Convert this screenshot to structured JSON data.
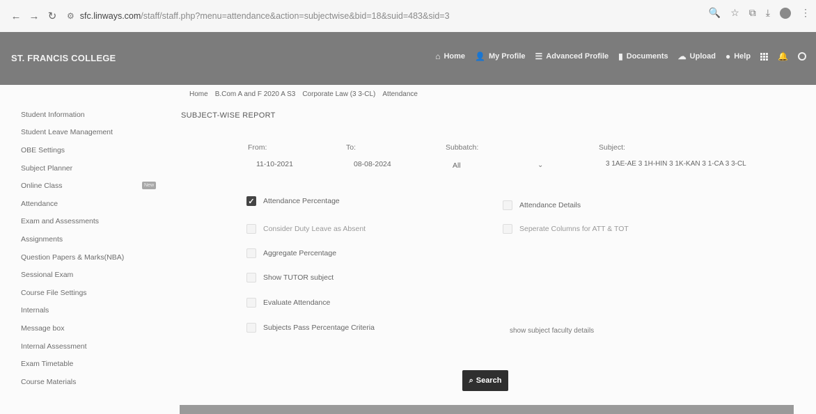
{
  "browser": {
    "url_domain": "sfc.linways.com",
    "url_path": "/staff/staff.php?menu=attendance&action=subjectwise&bid=18&suid=483&sid=3"
  },
  "app": {
    "brand": "ST. FRANCIS COLLEGE",
    "nav": [
      {
        "label": "Home",
        "icon": "home-icon"
      },
      {
        "label": "My Profile",
        "icon": "user-icon"
      },
      {
        "label": "Advanced Profile",
        "icon": "list-icon"
      },
      {
        "label": "Documents",
        "icon": "document-icon"
      },
      {
        "label": "Upload",
        "icon": "cloud-upload-icon"
      },
      {
        "label": "Help",
        "icon": "help-icon"
      }
    ]
  },
  "breadcrumb": [
    "Home",
    "B.Com A and F 2020 A  S3",
    "Corporate Law (3 3-CL)",
    "Attendance"
  ],
  "sidebar": {
    "items": [
      "Student Information",
      "Student Leave Management",
      "OBE Settings",
      "Subject Planner",
      "Online Class",
      "Attendance",
      "Exam and Assessments",
      "Assignments",
      "Question Papers & Marks(NBA)",
      "Sessional Exam",
      "Course File Settings",
      "Internals",
      "Message box",
      "Internal Assessment",
      "Exam Timetable",
      "Course Materials"
    ],
    "new_badge": "New"
  },
  "page_title": "SUBJECT-WISE REPORT",
  "filters": {
    "from_label": "From:",
    "from_value": "11-10-2021",
    "to_label": "To:",
    "to_value": "08-08-2024",
    "subbatch_label": "Subbatch:",
    "subbatch_value": "All",
    "subject_label": "Subject:",
    "subject_value": "3 1AE-AE  3 1H-HIN  3 1K-KAN  3 1-CA  3 3-CL"
  },
  "options": {
    "attendance_percentage": "Attendance Percentage",
    "attendance_details": "Attendance Details",
    "consider_duty_leave": "Consider Duty Leave as Absent",
    "separate_columns": "Seperate Columns for ATT & TOT",
    "aggregate_percentage": "Aggregate Percentage",
    "show_tutor_subject": "Show TUTOR subject",
    "evaluate_attendance": "Evaluate Attendance",
    "subjects_pass_percentage": "Subjects Pass Percentage Criteria",
    "show_subject_faculty": "show subject faculty details"
  },
  "search_label": "Search",
  "colors": {
    "header_bg": "#7c7c7c",
    "button_bg": "#2f2f2f"
  }
}
